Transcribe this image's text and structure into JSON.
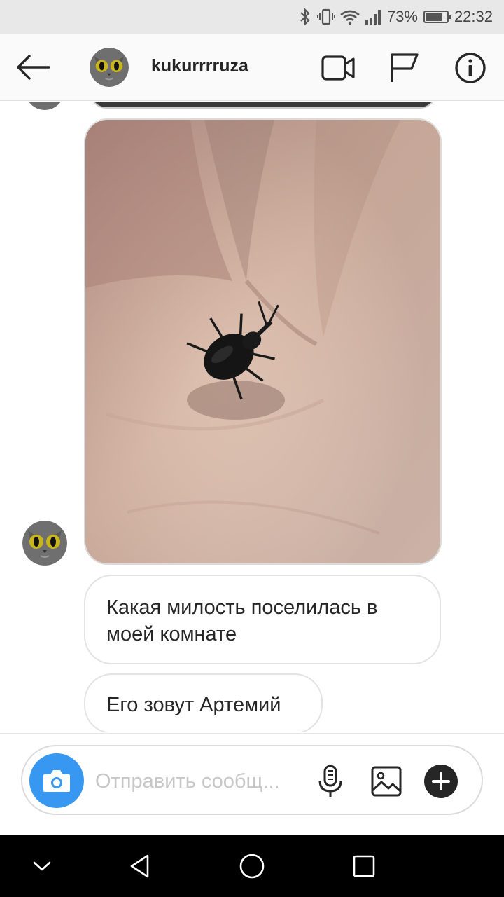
{
  "status_bar": {
    "battery_percent": "73%",
    "battery_level": 0.73,
    "time": "22:32",
    "icons": [
      "bluetooth-icon",
      "vibrate-icon",
      "wifi-icon",
      "signal-icon",
      "battery-icon"
    ]
  },
  "header": {
    "username": "kukurrrruza",
    "icons": [
      "back-arrow-icon",
      "video-call-icon",
      "flag-icon",
      "info-icon"
    ]
  },
  "messages": [
    {
      "type": "photo",
      "description_icon": "photo-beetle-on-palm"
    },
    {
      "type": "text",
      "text": "Какая милость поселилась в моей комнате"
    },
    {
      "type": "text",
      "text": "Его зовут Артемий"
    }
  ],
  "composer": {
    "placeholder": "Отправить сообщ...",
    "icons": [
      "camera-icon",
      "microphone-icon",
      "gallery-icon",
      "plus-icon"
    ]
  },
  "colors": {
    "accent": "#3897f0",
    "status_bar_bg": "#e8e8e8",
    "header_bg": "#fafafa",
    "nav_bg": "#000000"
  }
}
